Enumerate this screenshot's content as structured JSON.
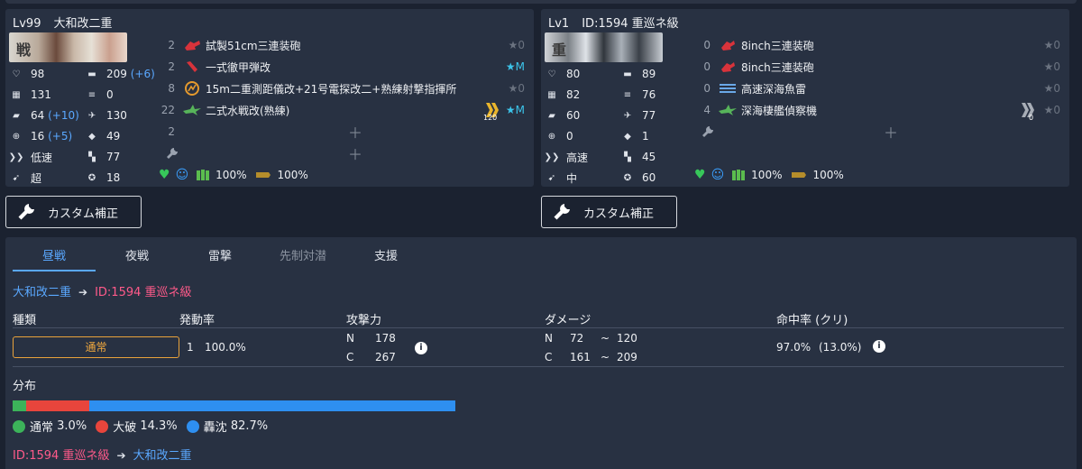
{
  "attacker": {
    "level": "Lv99",
    "name": "大和改二重",
    "stats": [
      {
        "icon": "hp-icon",
        "value": "98"
      },
      {
        "icon": "firepower-icon",
        "value": "209",
        "mod": "(+6)"
      },
      {
        "icon": "armor-icon",
        "value": "131"
      },
      {
        "icon": "torpedo-icon",
        "value": "0"
      },
      {
        "icon": "evasion-icon",
        "value": "64",
        "mod": "(+10)"
      },
      {
        "icon": "aa-icon",
        "value": "130"
      },
      {
        "icon": "accuracy-icon",
        "value": "16",
        "mod": "(+5)"
      },
      {
        "icon": "asw-icon",
        "value": "49"
      },
      {
        "icon": "speed-icon",
        "value": "低速"
      },
      {
        "icon": "los-icon",
        "value": "77"
      },
      {
        "icon": "range-icon",
        "value": "超"
      },
      {
        "icon": "luck-icon",
        "value": "18"
      }
    ],
    "equipment": [
      {
        "slot": "2",
        "icon": "large-gun-icon",
        "name": "試製51cm三連装砲",
        "improvement": "★0"
      },
      {
        "slot": "2",
        "icon": "ap-shell-icon",
        "name": "一式徹甲弾改",
        "improvement": "★M"
      },
      {
        "slot": "8",
        "icon": "radar-icon",
        "name": "15m二重測距儀改+21号電探改二+熟練射撃指揮所",
        "improvement": "★0"
      },
      {
        "slot": "22",
        "icon": "seaplane-fighter-icon",
        "name": "二式水戦改(熟練)",
        "improvement": "★M",
        "proficiency": "120"
      },
      {
        "slot": "2",
        "icon": "",
        "name": "",
        "improvement": ""
      },
      {
        "slot": "",
        "icon": "wrench-icon",
        "name": "",
        "improvement": ""
      }
    ],
    "status": {
      "fuel": "100%",
      "ammo": "100%"
    }
  },
  "defender": {
    "level": "Lv1",
    "name": "ID:1594 重巡ネ級",
    "stats": [
      {
        "icon": "hp-icon",
        "value": "80"
      },
      {
        "icon": "firepower-icon",
        "value": "89"
      },
      {
        "icon": "armor-icon",
        "value": "82"
      },
      {
        "icon": "torpedo-icon",
        "value": "76"
      },
      {
        "icon": "evasion-icon",
        "value": "60"
      },
      {
        "icon": "aa-icon",
        "value": "77"
      },
      {
        "icon": "accuracy-icon",
        "value": "0"
      },
      {
        "icon": "asw-icon",
        "value": "1"
      },
      {
        "icon": "speed-icon",
        "value": "高速"
      },
      {
        "icon": "los-icon",
        "value": "45"
      },
      {
        "icon": "range-icon",
        "value": "中"
      },
      {
        "icon": "luck-icon",
        "value": "60"
      }
    ],
    "equipment": [
      {
        "slot": "0",
        "icon": "medium-gun-icon",
        "name": "8inch三連装砲",
        "improvement": "★0"
      },
      {
        "slot": "0",
        "icon": "medium-gun-icon",
        "name": "8inch三連装砲",
        "improvement": "★0"
      },
      {
        "slot": "0",
        "icon": "torpedo-equip-icon",
        "name": "高速深海魚雷",
        "improvement": "★0"
      },
      {
        "slot": "4",
        "icon": "recon-seaplane-icon",
        "name": "深海棲艦偵察機",
        "improvement": "★0",
        "proficiency": "0"
      },
      {
        "slot": "",
        "icon": "wrench-icon",
        "name": "",
        "improvement": ""
      }
    ],
    "status": {
      "fuel": "100%",
      "ammo": "100%"
    }
  },
  "buttons": {
    "custom_correction": "カスタム補正"
  },
  "tabs": [
    "昼戦",
    "夜戦",
    "雷撃",
    "先制対潜",
    "支援"
  ],
  "route_top": {
    "from": "大和改二重",
    "to": "ID:1594 重巡ネ級"
  },
  "table": {
    "headers": [
      "種類",
      "発動率",
      "攻撃力",
      "ダメージ",
      "命中率 (クリ)"
    ],
    "row": {
      "type": "通常",
      "rate_count": "1",
      "rate": "100.0%",
      "power_n_label": "N",
      "power_n": "178",
      "power_c_label": "C",
      "power_c": "267",
      "dmg_n_label": "N",
      "dmg_n_min": "72",
      "dmg_n_sep": "~",
      "dmg_n_max": "120",
      "dmg_c_label": "C",
      "dmg_c_min": "161",
      "dmg_c_sep": "~",
      "dmg_c_max": "209",
      "hit": "97.0%",
      "crit": "(13.0%)"
    }
  },
  "distribution": {
    "label": "分布",
    "segments": [
      {
        "name": "通常",
        "value": "3.0%",
        "fraction": 0.03,
        "color": "#3cb35a"
      },
      {
        "name": "大破",
        "value": "14.3%",
        "fraction": 0.143,
        "color": "#e8453c"
      },
      {
        "name": "轟沈",
        "value": "82.7%",
        "fraction": 0.827,
        "color": "#2e8ff0"
      }
    ]
  },
  "route_bottom": {
    "from": "ID:1594 重巡ネ級",
    "to": "大和改二重"
  }
}
